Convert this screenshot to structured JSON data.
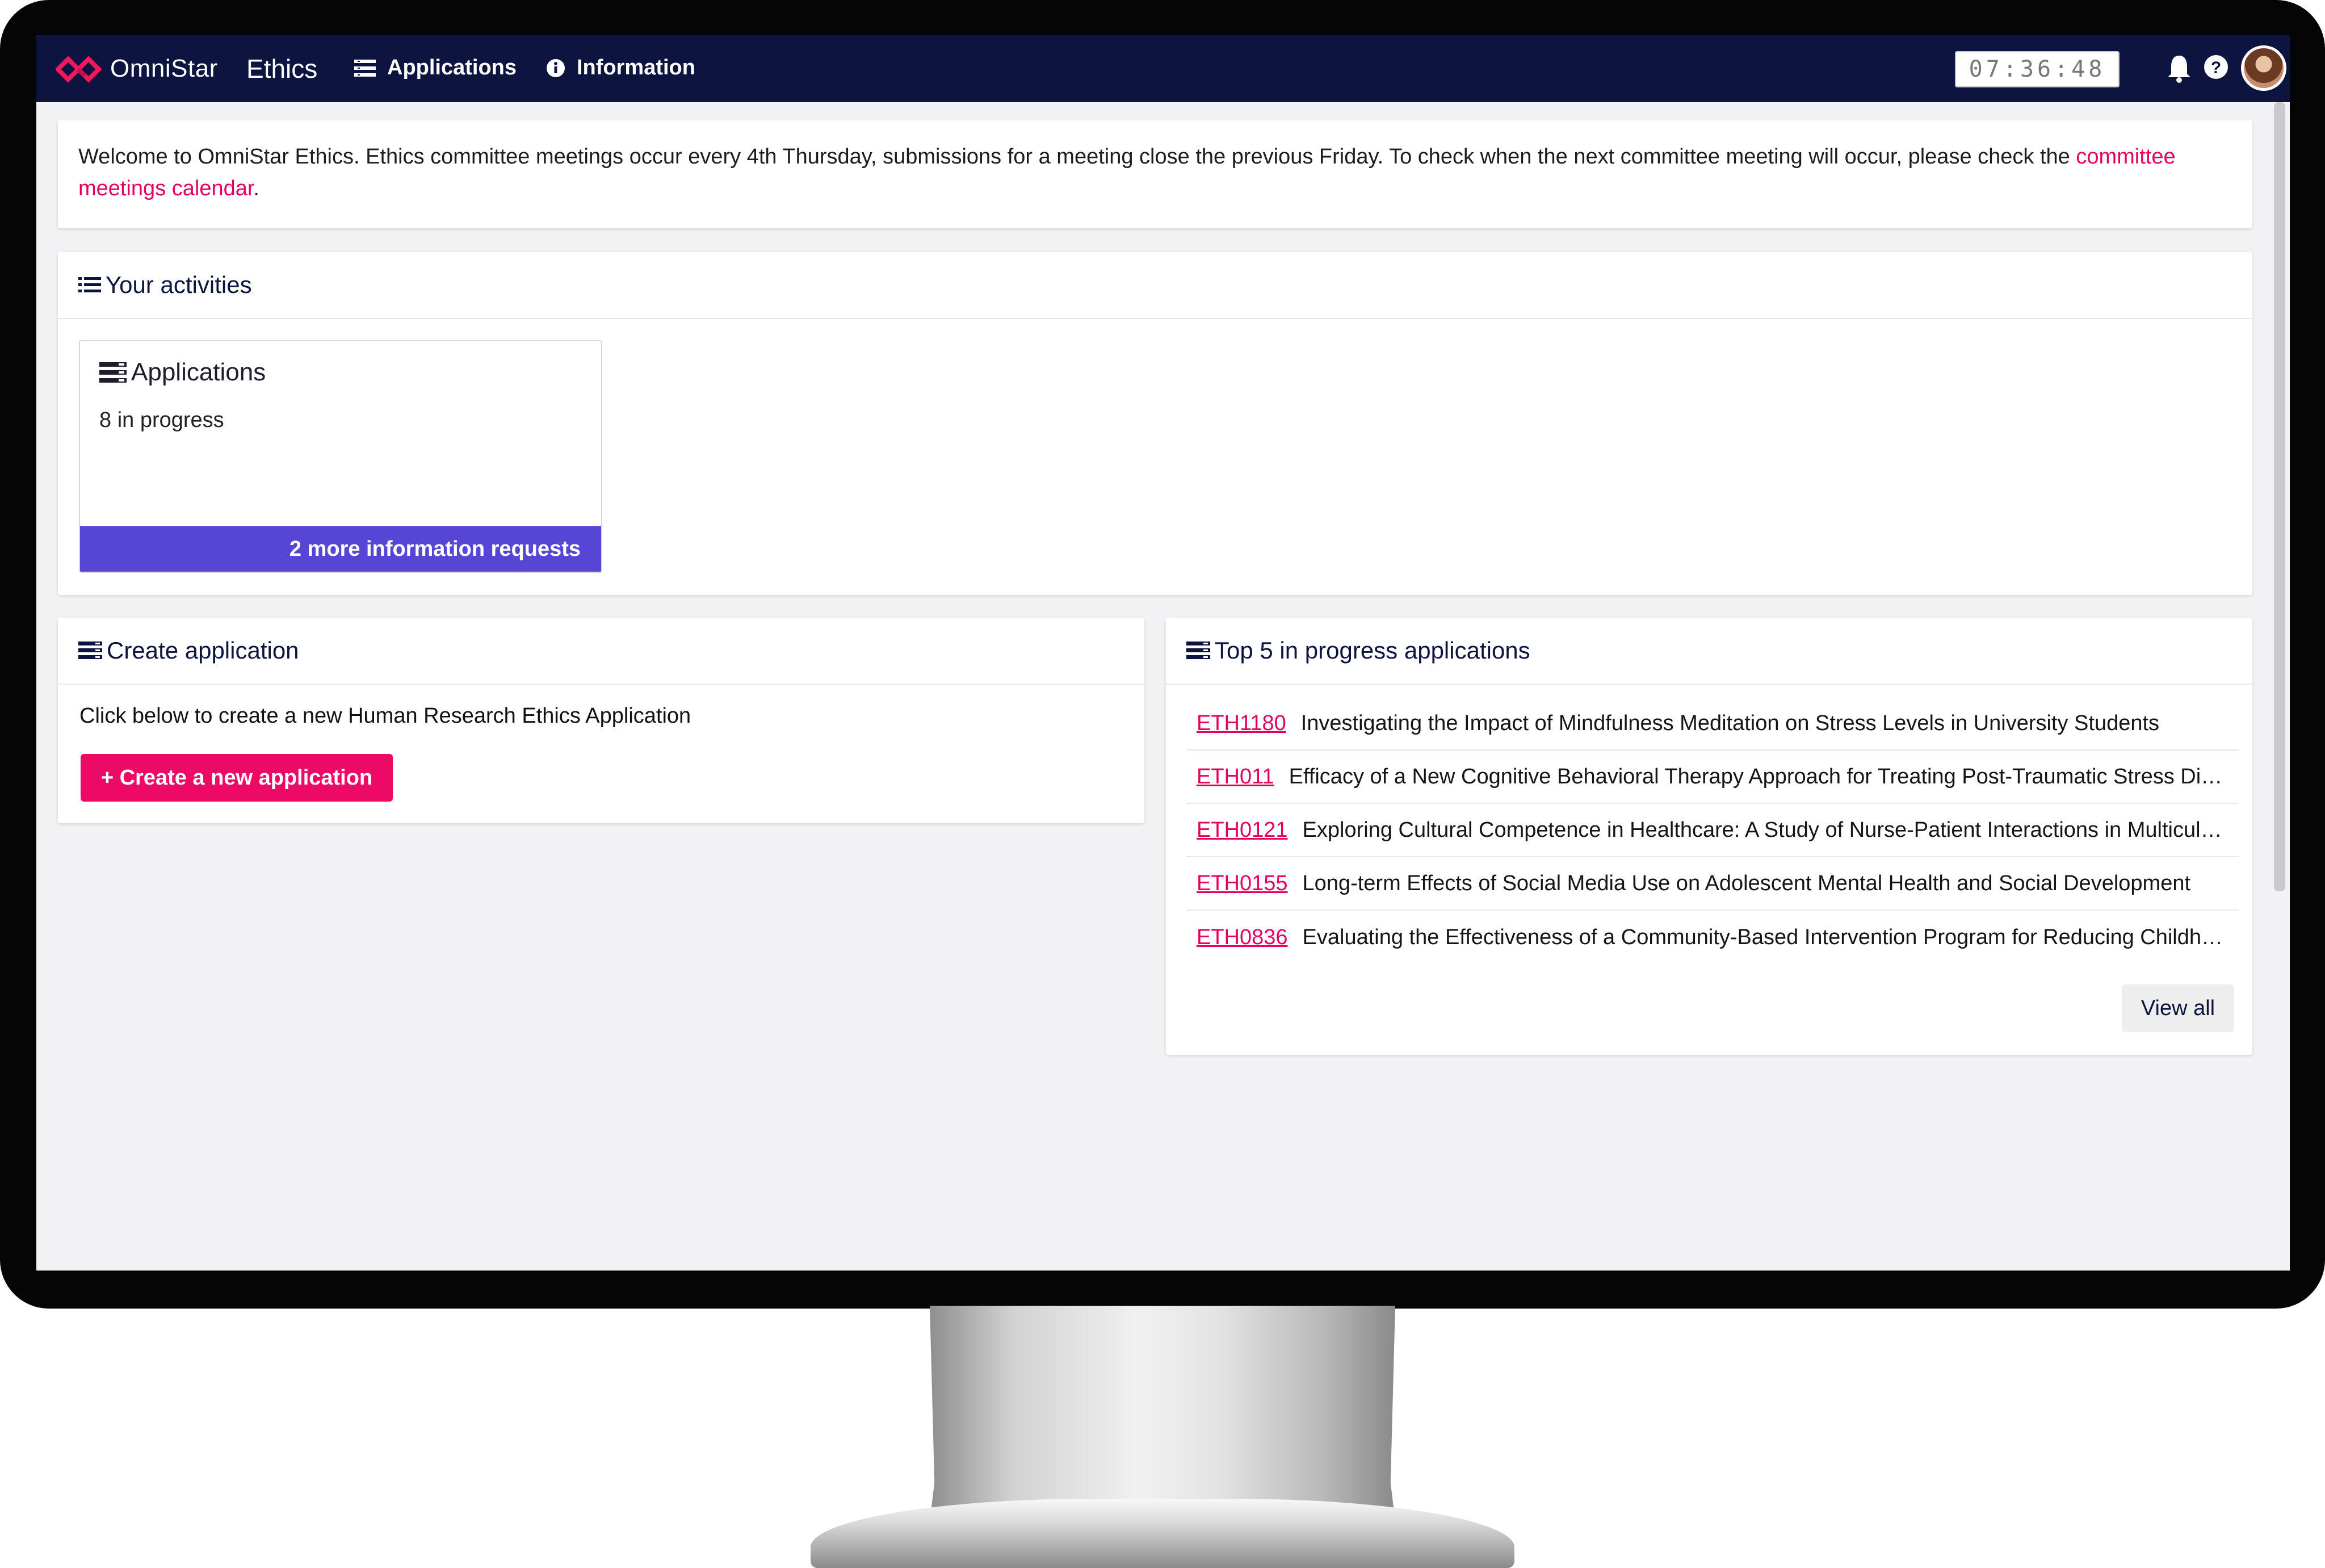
{
  "header": {
    "brand_name": "OmniStar",
    "product": "Ethics",
    "nav": [
      {
        "label": "Applications",
        "icon": "list-alt-icon"
      },
      {
        "label": "Information",
        "icon": "info-circle-icon"
      }
    ],
    "clock": "07:36:48",
    "icons": [
      "bell-icon",
      "question-circle-icon",
      "avatar"
    ]
  },
  "welcome": {
    "text": "Welcome to OmniStar Ethics.  Ethics committee meetings occur every 4th Thursday, submissions for a meeting close the previous Friday.  To check when the next committee meeting will occur, please check the ",
    "link": "committee meetings calendar",
    "suffix": "."
  },
  "activities": {
    "title": "Your activities",
    "card": {
      "title": "Applications",
      "subtitle": "8 in progress",
      "footer": "2 more information requests"
    }
  },
  "create": {
    "title": "Create application",
    "description": "Click below to create a new Human Research Ethics Application",
    "button": "+ Create a new application"
  },
  "top5": {
    "title": "Top 5 in progress applications",
    "rows": [
      {
        "code": "ETH1180",
        "title": "Investigating the Impact of Mindfulness Meditation on Stress Levels in University Students"
      },
      {
        "code": "ETH011",
        "title": "Efficacy of a New Cognitive Behavioral Therapy Approach for Treating Post-Traumatic Stress Disorder"
      },
      {
        "code": "ETH0121",
        "title": "Exploring Cultural Competence in Healthcare: A Study of Nurse-Patient Interactions in Multicultural Settings"
      },
      {
        "code": "ETH0155",
        "title": "Long-term Effects of Social Media Use on Adolescent Mental Health and Social Development"
      },
      {
        "code": "ETH0836",
        "title": "Evaluating the Effectiveness of a Community-Based Intervention Program for Reducing Childhood Obesity"
      }
    ],
    "view_all": "View all"
  },
  "colors": {
    "navbar": "#0d1440",
    "accent": "#e4005f",
    "button": "#ec0a66",
    "card_footer": "#5745d6"
  }
}
